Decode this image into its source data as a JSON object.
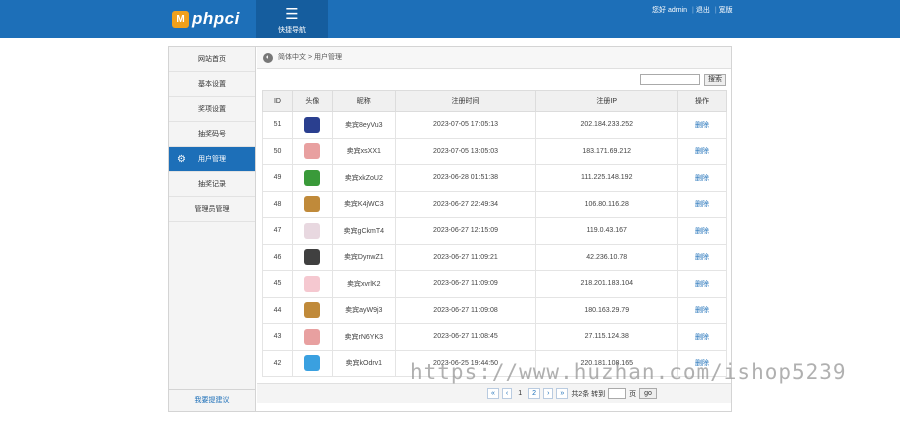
{
  "header": {
    "logo_badge": "M",
    "logo_text": "phpci",
    "quicknav_label": "快捷导航",
    "greeting": "您好 admin",
    "logout": "退出",
    "home": "宽版"
  },
  "sidebar": {
    "items": [
      {
        "label": "网站首页",
        "active": false
      },
      {
        "label": "基本设置",
        "active": false
      },
      {
        "label": "奖项设置",
        "active": false
      },
      {
        "label": "抽奖码号",
        "active": false
      },
      {
        "label": "用户管理",
        "active": true
      },
      {
        "label": "抽奖记录",
        "active": false
      },
      {
        "label": "管理员管理",
        "active": false
      }
    ],
    "feedback": "我要提建议"
  },
  "breadcrumb": "简体中文 > 用户管理",
  "search": {
    "placeholder": "",
    "button": "搜索"
  },
  "table": {
    "headers": [
      "ID",
      "头像",
      "昵称",
      "注册时间",
      "注册IP",
      "操作"
    ],
    "rows": [
      {
        "id": "51",
        "avatar_color": "#2a3f8f",
        "nick": "卖宾8eyVu3",
        "time": "2023-07-05 17:05:13",
        "ip": "202.184.233.252",
        "op": "删除"
      },
      {
        "id": "50",
        "avatar_color": "#e8a0a0",
        "nick": "卖宾xsXX1",
        "time": "2023-07-05 13:05:03",
        "ip": "183.171.69.212",
        "op": "删除"
      },
      {
        "id": "49",
        "avatar_color": "#3a9a3a",
        "nick": "卖宾xkZoU2",
        "time": "2023-06-28 01:51:38",
        "ip": "111.225.148.192",
        "op": "删除"
      },
      {
        "id": "48",
        "avatar_color": "#c08a3a",
        "nick": "卖宾K4jWC3",
        "time": "2023-06-27 22:49:34",
        "ip": "106.80.116.28",
        "op": "删除"
      },
      {
        "id": "47",
        "avatar_color": "#e8d8e0",
        "nick": "卖宾gCkmT4",
        "time": "2023-06-27 12:15:09",
        "ip": "119.0.43.167",
        "op": "删除"
      },
      {
        "id": "46",
        "avatar_color": "#404040",
        "nick": "卖宾DynwZ1",
        "time": "2023-06-27 11:09:21",
        "ip": "42.236.10.78",
        "op": "删除"
      },
      {
        "id": "45",
        "avatar_color": "#f5c8d0",
        "nick": "卖宾xvrlK2",
        "time": "2023-06-27 11:09:09",
        "ip": "218.201.183.104",
        "op": "删除"
      },
      {
        "id": "44",
        "avatar_color": "#c08a3a",
        "nick": "卖宾ayW9j3",
        "time": "2023-06-27 11:09:08",
        "ip": "180.163.29.79",
        "op": "删除"
      },
      {
        "id": "43",
        "avatar_color": "#e8a0a0",
        "nick": "卖宾rN6YK3",
        "time": "2023-06-27 11:08:45",
        "ip": "27.115.124.38",
        "op": "删除"
      },
      {
        "id": "42",
        "avatar_color": "#3aa0e0",
        "nick": "卖宾kOdrv1",
        "time": "2023-06-25 19:44:50",
        "ip": "220.181.108.165",
        "op": "删除"
      }
    ]
  },
  "pager": {
    "first": "«",
    "prev": "‹",
    "pages": [
      "1",
      "2"
    ],
    "current": "2",
    "next": "›",
    "last": "»",
    "total_text": "共2条 转到",
    "page_unit": "页",
    "go": "go"
  },
  "watermark": "https://www.huzhan.com/ishop5239"
}
